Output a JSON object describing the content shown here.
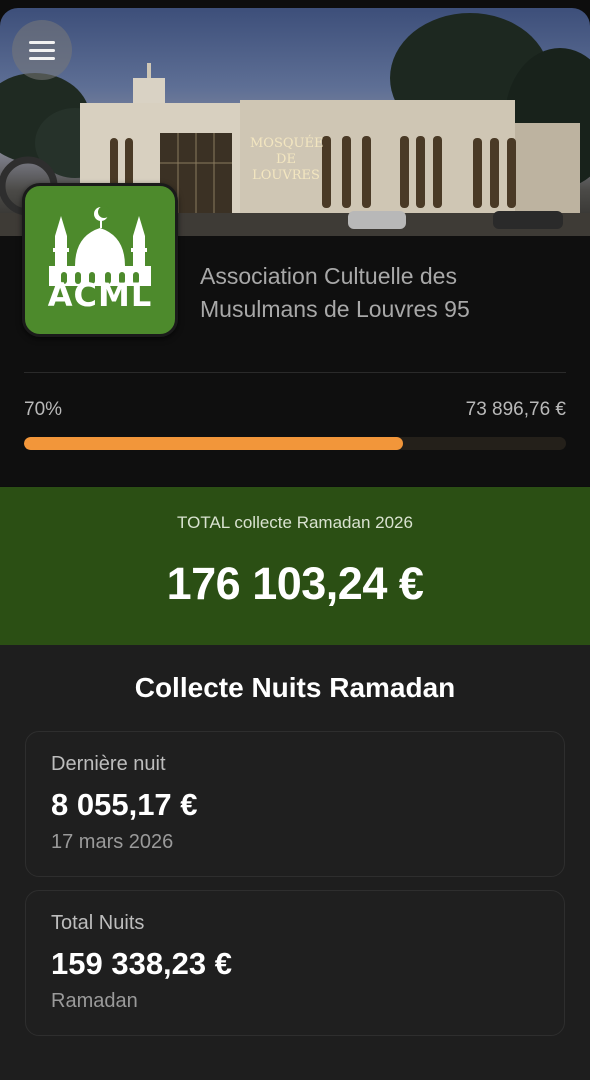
{
  "hero": {
    "mosque_sign": [
      "MOSQUÉE",
      "DE",
      "LOUVRES"
    ]
  },
  "logo": {
    "text": "ACML",
    "bg_color": "#4d8a2c"
  },
  "organization": {
    "name": "Association Cultuelle des Musulmans de Louvres 95"
  },
  "progress": {
    "percent_label": "70%",
    "amount_label": "73 896,76 €",
    "fraction": 0.7,
    "fill_color": "#f2963a"
  },
  "total": {
    "label": "TOTAL collecte Ramadan 2026",
    "value": "176 103,24 €",
    "band_color": "#2b4f14"
  },
  "collecte": {
    "title": "Collecte Nuits Ramadan",
    "cards": [
      {
        "label": "Dernière nuit",
        "value": "8 055,17 €",
        "sub": "17 mars 2026"
      },
      {
        "label": "Total Nuits",
        "value": "159 338,23 €",
        "sub": "Ramadan"
      }
    ]
  }
}
